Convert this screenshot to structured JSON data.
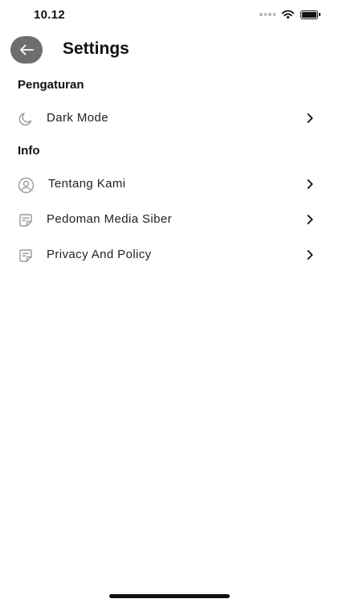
{
  "status_bar": {
    "time": "10.12"
  },
  "header": {
    "title": "Settings"
  },
  "sections": [
    {
      "title": "Pengaturan",
      "items": [
        {
          "label": "Dark Mode",
          "icon": "moon-icon"
        }
      ]
    },
    {
      "title": "Info",
      "items": [
        {
          "label": "Tentang Kami",
          "icon": "user-circle-icon"
        },
        {
          "label": "Pedoman Media Siber",
          "icon": "note-icon"
        },
        {
          "label": "Privacy And Policy",
          "icon": "note-icon"
        }
      ]
    }
  ],
  "colors": {
    "back_button_bg": "#6e6e6e",
    "icon_gray": "#9a9a9a",
    "text": "#111111"
  }
}
